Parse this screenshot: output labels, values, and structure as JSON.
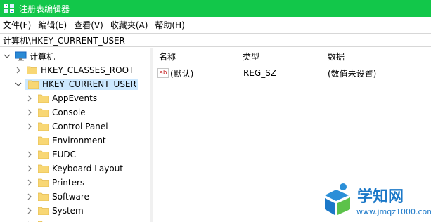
{
  "window": {
    "title": "注册表编辑器"
  },
  "menu": {
    "items": [
      "文件(F)",
      "编辑(E)",
      "查看(V)",
      "收藏夹(A)",
      "帮助(H)"
    ]
  },
  "address": {
    "path": "计算机\\HKEY_CURRENT_USER"
  },
  "tree": {
    "root": "计算机",
    "hives": [
      "HKEY_CLASSES_ROOT",
      "HKEY_CURRENT_USER"
    ],
    "children": [
      "AppEvents",
      "Console",
      "Control Panel",
      "Environment",
      "EUDC",
      "Keyboard Layout",
      "Printers",
      "Software",
      "System"
    ]
  },
  "list": {
    "columns": [
      "名称",
      "类型",
      "数据"
    ],
    "rows": [
      {
        "name": "(默认)",
        "type": "REG_SZ",
        "data": "(数值未设置)"
      }
    ]
  },
  "watermark": {
    "brand": "学知网",
    "url": "www.jmqz1000.com"
  },
  "colors": {
    "titlebar": "#12c74a",
    "selection": "#cce8ff",
    "folder": "#f8d775",
    "watermark": "#1b78c8"
  }
}
